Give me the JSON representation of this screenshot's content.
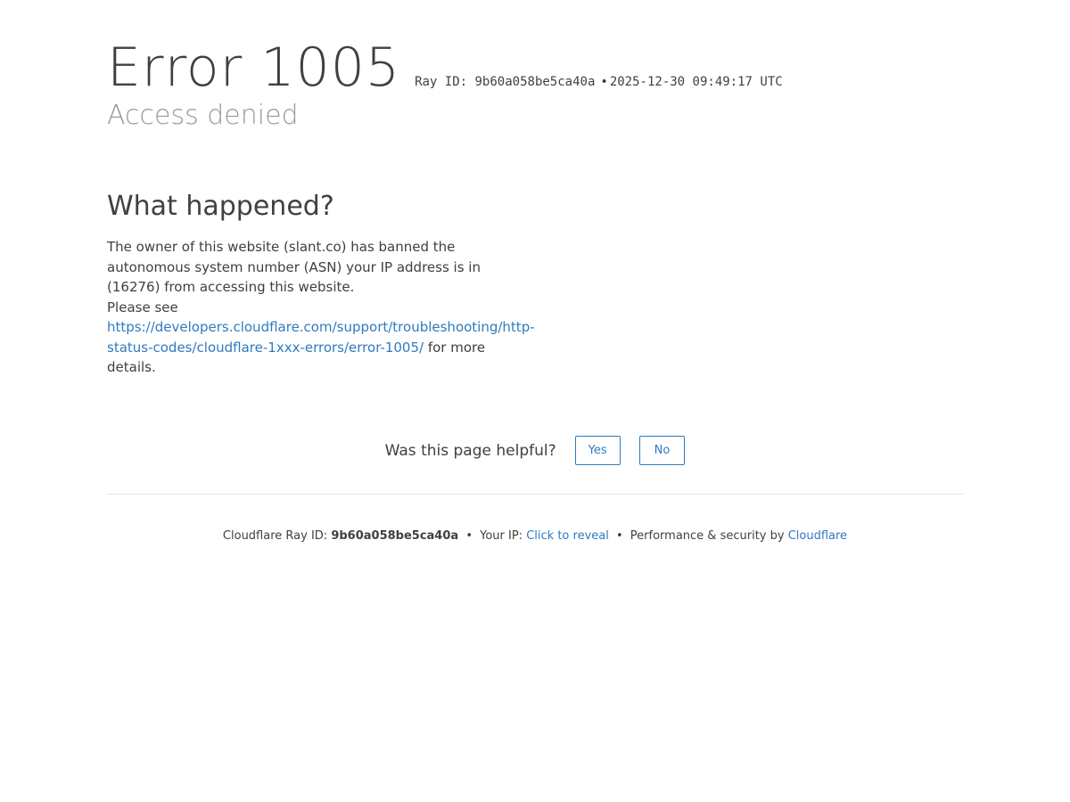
{
  "header": {
    "error_title": "Error 1005",
    "ray_id_text": "Ray ID: 9b60a058be5ca40a",
    "bullet": "•",
    "timestamp": "2025-12-30 09:49:17 UTC",
    "subtitle": "Access denied"
  },
  "what_happened": {
    "heading": "What happened?",
    "body_text": "The owner of this website (slant.co) has banned the autonomous system number (ASN) your IP address is in (16276) from accessing this website.",
    "please_see": "Please see",
    "link_text": "https://developers.cloudflare.com/support/troubleshooting/http-status-codes/cloudflare-1xxx-errors/error-1005/",
    "after_link": "for more details."
  },
  "feedback": {
    "question": "Was this page helpful?",
    "yes_label": "Yes",
    "no_label": "No"
  },
  "footer": {
    "ray_label": "Cloudflare Ray ID:",
    "ray_value": "9b60a058be5ca40a",
    "bullet": "•",
    "ip_label": "Your IP:",
    "ip_reveal": "Click to reveal",
    "perf_label": "Performance & security by",
    "cloudflare_link": "Cloudflare"
  },
  "colors": {
    "text": "#404040",
    "subtitle": "#999999",
    "link": "#2f7bbf",
    "divider": "#e5e5e5"
  }
}
